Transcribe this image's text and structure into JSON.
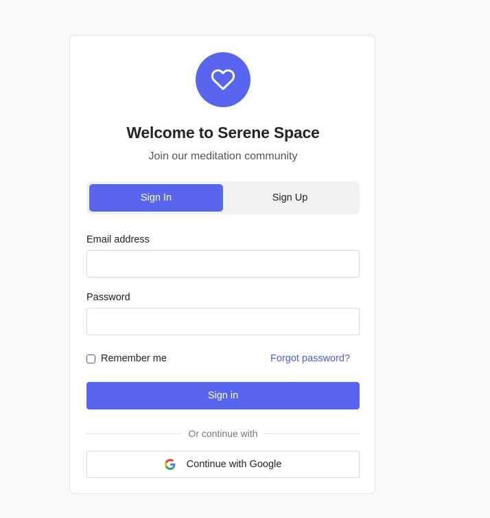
{
  "app": {
    "title": "Welcome to Serene Space",
    "subtitle": "Join our meditation community",
    "logo_icon": "heart-icon",
    "accent_color": "#5865ee"
  },
  "tabs": [
    {
      "label": "Sign In",
      "active": true
    },
    {
      "label": "Sign Up",
      "active": false
    }
  ],
  "form": {
    "email": {
      "label": "Email address",
      "value": "",
      "placeholder": ""
    },
    "password": {
      "label": "Password",
      "value": "",
      "placeholder": ""
    },
    "remember_label": "Remember me",
    "remember_checked": false,
    "forgot_label": "Forgot password?",
    "submit_label": "Sign in"
  },
  "divider_text": "Or continue with",
  "social": {
    "google_label": "Continue with Google",
    "google_icon": "google-icon"
  }
}
